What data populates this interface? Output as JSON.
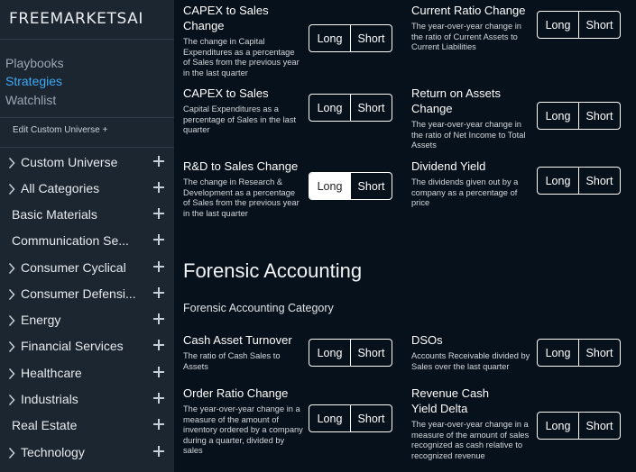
{
  "brand": "FREEMARKETSAI",
  "nav": {
    "playbooks": "Playbooks",
    "strategies": "Strategies",
    "watchlist": "Watchlist",
    "edit_universe": "Edit Custom Universe +"
  },
  "categories": [
    {
      "label": "Custom Universe",
      "chevron": true
    },
    {
      "label": "All Categories",
      "chevron": true
    },
    {
      "label": "Basic Materials",
      "chevron": false
    },
    {
      "label": "Communication Se...",
      "chevron": false
    },
    {
      "label": "Consumer Cyclical",
      "chevron": true
    },
    {
      "label": "Consumer Defensi...",
      "chevron": true
    },
    {
      "label": "Energy",
      "chevron": true
    },
    {
      "label": "Financial Services",
      "chevron": true
    },
    {
      "label": "Healthcare",
      "chevron": true
    },
    {
      "label": "Industrials",
      "chevron": true
    },
    {
      "label": "Real Estate",
      "chevron": false
    },
    {
      "label": "Technology",
      "chevron": true
    }
  ],
  "toggle": {
    "long": "Long",
    "short": "Short"
  },
  "strategies": [
    {
      "title": "CAPEX to Sales Change",
      "desc": "The change in Capital Expenditures as a percentage of Sales from the previous year in the last quarter",
      "selected": ""
    },
    {
      "title": "Current Ratio Change",
      "desc": "The year-over-year change in the ratio of Current Assets to Current Liabilities",
      "selected": ""
    },
    {
      "title": "CAPEX to Sales",
      "desc": "Capital Expenditures as a percentage of Sales in the last quarter",
      "selected": ""
    },
    {
      "title": "Return on Assets Change",
      "desc": "The year-over-year change in the ratio of Net Income to Total Assets",
      "selected": ""
    },
    {
      "title": "R&D to Sales Change",
      "desc": "The change in Research & Development as a percentage of Sales from the previous year in the last quarter",
      "selected": "long"
    },
    {
      "title": "Dividend Yield",
      "desc": "The dividends given out by a company as a percentage of price",
      "selected": ""
    },
    {
      "title": "Cash Asset Turnover",
      "desc": "The ratio of Cash Sales to Assets",
      "selected": ""
    },
    {
      "title": "DSOs",
      "desc": "Accounts Receivable divided by Sales over the last quarter",
      "selected": ""
    },
    {
      "title": "Order Ratio Change",
      "desc": "The year-over-year change in a measure of the amount of inventory ordered by a company during a quarter, divided by sales",
      "selected": ""
    },
    {
      "title": "Revenue Cash Yield Delta",
      "desc": "The year-over-year change in a measure of the amount of sales recognized as cash relative to recognized revenue",
      "selected": ""
    }
  ],
  "section": {
    "title": "Forensic Accounting",
    "subtitle": "Forensic Accounting Category"
  }
}
